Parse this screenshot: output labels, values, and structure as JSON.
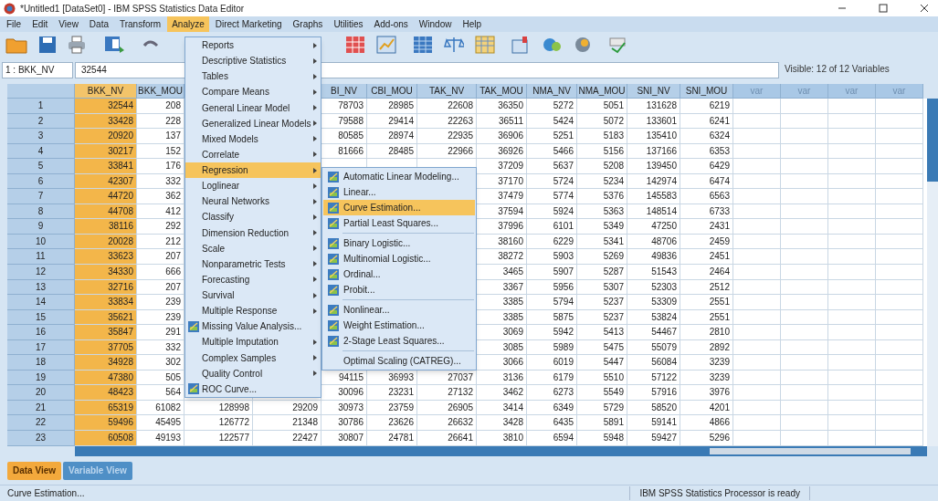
{
  "window": {
    "title": "*Untitled1 [DataSet0] - IBM SPSS Statistics Data Editor"
  },
  "menu_bar": [
    {
      "label": "File",
      "selected": false
    },
    {
      "label": "Edit",
      "selected": false
    },
    {
      "label": "View",
      "selected": false
    },
    {
      "label": "Data",
      "selected": false
    },
    {
      "label": "Transform",
      "selected": false
    },
    {
      "label": "Analyze",
      "selected": true
    },
    {
      "label": "Direct Marketing",
      "selected": false
    },
    {
      "label": "Graphs",
      "selected": false
    },
    {
      "label": "Utilities",
      "selected": false
    },
    {
      "label": "Add-ons",
      "selected": false
    },
    {
      "label": "Window",
      "selected": false
    },
    {
      "label": "Help",
      "selected": false
    }
  ],
  "analyze_menu": {
    "items": [
      {
        "label": "Reports",
        "has_submenu": true,
        "has_icon": false,
        "selected": false
      },
      {
        "label": "Descriptive Statistics",
        "has_submenu": true,
        "has_icon": false,
        "selected": false
      },
      {
        "label": "Tables",
        "has_submenu": true,
        "has_icon": false,
        "selected": false
      },
      {
        "label": "Compare Means",
        "has_submenu": true,
        "has_icon": false,
        "selected": false
      },
      {
        "label": "General Linear Model",
        "has_submenu": true,
        "has_icon": false,
        "selected": false
      },
      {
        "label": "Generalized Linear Models",
        "has_submenu": true,
        "has_icon": false,
        "selected": false
      },
      {
        "label": "Mixed Models",
        "has_submenu": true,
        "has_icon": false,
        "selected": false
      },
      {
        "label": "Correlate",
        "has_submenu": true,
        "has_icon": false,
        "selected": false
      },
      {
        "label": "Regression",
        "has_submenu": true,
        "has_icon": false,
        "selected": true
      },
      {
        "label": "Loglinear",
        "has_submenu": true,
        "has_icon": false,
        "selected": false
      },
      {
        "label": "Neural Networks",
        "has_submenu": true,
        "has_icon": false,
        "selected": false
      },
      {
        "label": "Classify",
        "has_submenu": true,
        "has_icon": false,
        "selected": false
      },
      {
        "label": "Dimension Reduction",
        "has_submenu": true,
        "has_icon": false,
        "selected": false
      },
      {
        "label": "Scale",
        "has_submenu": true,
        "has_icon": false,
        "selected": false
      },
      {
        "label": "Nonparametric Tests",
        "has_submenu": true,
        "has_icon": false,
        "selected": false
      },
      {
        "label": "Forecasting",
        "has_submenu": true,
        "has_icon": false,
        "selected": false
      },
      {
        "label": "Survival",
        "has_submenu": true,
        "has_icon": false,
        "selected": false
      },
      {
        "label": "Multiple Response",
        "has_submenu": true,
        "has_icon": false,
        "selected": false
      },
      {
        "label": "Missing Value Analysis...",
        "has_submenu": false,
        "has_icon": true,
        "selected": false
      },
      {
        "label": "Multiple Imputation",
        "has_submenu": true,
        "has_icon": false,
        "selected": false
      },
      {
        "label": "Complex Samples",
        "has_submenu": true,
        "has_icon": false,
        "selected": false
      },
      {
        "label": "Quality Control",
        "has_submenu": true,
        "has_icon": false,
        "selected": false
      },
      {
        "label": "ROC Curve...",
        "has_submenu": false,
        "has_icon": true,
        "selected": false
      }
    ]
  },
  "regression_submenu": {
    "groups": [
      [
        {
          "label": "Automatic Linear Modeling...",
          "has_icon": true,
          "selected": false
        },
        {
          "label": "Linear...",
          "has_icon": true,
          "selected": false
        },
        {
          "label": "Curve Estimation...",
          "has_icon": true,
          "selected": true
        },
        {
          "label": "Partial Least Squares...",
          "has_icon": true,
          "selected": false
        }
      ],
      [
        {
          "label": "Binary Logistic...",
          "has_icon": true,
          "selected": false
        },
        {
          "label": "Multinomial Logistic...",
          "has_icon": true,
          "selected": false
        },
        {
          "label": "Ordinal...",
          "has_icon": true,
          "selected": false
        },
        {
          "label": "Probit...",
          "has_icon": true,
          "selected": false
        }
      ],
      [
        {
          "label": "Nonlinear...",
          "has_icon": true,
          "selected": false
        },
        {
          "label": "Weight Estimation...",
          "has_icon": true,
          "selected": false
        },
        {
          "label": "2-Stage Least Squares...",
          "has_icon": true,
          "selected": false
        }
      ],
      [
        {
          "label": "Optimal Scaling (CATREG)...",
          "has_icon": false,
          "selected": false
        }
      ]
    ]
  },
  "cell_bar": {
    "cell_ref": "1 : BKK_NV",
    "value": "32544",
    "visible_count": "Visible: 12 of 12 Variables"
  },
  "table": {
    "columns": [
      {
        "label": "BKK_NV",
        "kind": "variable",
        "selected": true
      },
      {
        "label": "BKK_MOU",
        "kind": "variable",
        "selected": false
      },
      {
        "kind": "variable",
        "selected": false
      },
      {
        "kind": "variable",
        "selected": false
      },
      {
        "label": "BI_NV",
        "kind": "variable",
        "selected": false
      },
      {
        "label": "CBI_MOU",
        "kind": "variable",
        "selected": false
      },
      {
        "label": "TAK_NV",
        "kind": "variable",
        "selected": false
      },
      {
        "label": "TAK_MOU",
        "kind": "variable",
        "selected": false
      },
      {
        "label": "NMA_NV",
        "kind": "variable",
        "selected": false
      },
      {
        "label": "NMA_MOU",
        "kind": "variable",
        "selected": false
      },
      {
        "label": "SNI_NV",
        "kind": "variable",
        "selected": false
      },
      {
        "label": "SNI_MOU",
        "kind": "variable",
        "selected": false
      },
      {
        "label": "var",
        "kind": "placeholder",
        "selected": false
      },
      {
        "label": "var",
        "kind": "placeholder",
        "selected": false
      },
      {
        "label": "var",
        "kind": "placeholder",
        "selected": false
      },
      {
        "label": "var",
        "kind": "placeholder",
        "selected": false
      }
    ],
    "rows": [
      {
        "number": "1",
        "cells": [
          "32544",
          "208",
          null,
          null,
          "78703",
          "28985",
          "22608",
          "36350",
          "5272",
          "5051",
          "131628",
          "6219"
        ]
      },
      {
        "number": "2",
        "cells": [
          "33428",
          "228",
          null,
          null,
          "79588",
          "29414",
          "22263",
          "36511",
          "5424",
          "5072",
          "133601",
          "6241"
        ]
      },
      {
        "number": "3",
        "cells": [
          "20920",
          "137",
          null,
          null,
          "80585",
          "28974",
          "22935",
          "36906",
          "5251",
          "5183",
          "135410",
          "6324"
        ]
      },
      {
        "number": "4",
        "cells": [
          "30217",
          "152",
          null,
          null,
          "81666",
          "28485",
          "22966",
          "36926",
          "5466",
          "5156",
          "137166",
          "6353"
        ]
      },
      {
        "number": "5",
        "cells": [
          "33841",
          "176",
          null,
          null,
          null,
          null,
          null,
          "37209",
          "5637",
          "5208",
          "139450",
          "6429"
        ]
      },
      {
        "number": "6",
        "cells": [
          "42307",
          "332",
          null,
          null,
          null,
          null,
          null,
          "37170",
          "5724",
          "5234",
          "142974",
          "6474"
        ]
      },
      {
        "number": "7",
        "cells": [
          "44720",
          "362",
          null,
          null,
          null,
          null,
          null,
          "37479",
          "5774",
          "5376",
          "145583",
          "6563"
        ]
      },
      {
        "number": "8",
        "cells": [
          "44708",
          "412",
          null,
          null,
          null,
          null,
          null,
          "37594",
          "5924",
          "5363",
          "148514",
          "6733"
        ]
      },
      {
        "number": "9",
        "cells": [
          "38116",
          "292",
          null,
          null,
          null,
          null,
          null,
          "37996",
          "6101",
          "5349",
          "47250",
          "2431"
        ]
      },
      {
        "number": "10",
        "cells": [
          "20028",
          "212",
          null,
          null,
          null,
          null,
          null,
          "38160",
          "6229",
          "5341",
          "48706",
          "2459"
        ]
      },
      {
        "number": "11",
        "cells": [
          "33623",
          "207",
          null,
          null,
          null,
          null,
          null,
          "38272",
          "5903",
          "5269",
          "49836",
          "2451"
        ]
      },
      {
        "number": "12",
        "cells": [
          "34330",
          "666",
          null,
          null,
          null,
          null,
          null,
          "3465",
          "5907",
          "5287",
          "51543",
          "2464"
        ]
      },
      {
        "number": "13",
        "cells": [
          "32716",
          "207",
          null,
          null,
          null,
          null,
          null,
          "3367",
          "5956",
          "5307",
          "52303",
          "2512"
        ]
      },
      {
        "number": "14",
        "cells": [
          "33834",
          "239",
          null,
          null,
          null,
          null,
          null,
          "3385",
          "5794",
          "5237",
          "53309",
          "2551"
        ]
      },
      {
        "number": "15",
        "cells": [
          "35621",
          "239",
          null,
          null,
          null,
          null,
          null,
          "3385",
          "5875",
          "5237",
          "53824",
          "2551"
        ]
      },
      {
        "number": "16",
        "cells": [
          "35847",
          "291",
          null,
          null,
          null,
          null,
          null,
          "3069",
          "5942",
          "5413",
          "54467",
          "2810"
        ]
      },
      {
        "number": "17",
        "cells": [
          "37705",
          "332",
          null,
          null,
          null,
          null,
          null,
          "3085",
          "5989",
          "5475",
          "55079",
          "2892"
        ]
      },
      {
        "number": "18",
        "cells": [
          "34928",
          "302",
          null,
          null,
          null,
          null,
          null,
          "3066",
          "6019",
          "5447",
          "56084",
          "3239"
        ]
      },
      {
        "number": "19",
        "cells": [
          "47380",
          "505",
          null,
          null,
          "94115",
          "36993",
          "27037",
          "3136",
          "6179",
          "5510",
          "57122",
          "3239"
        ]
      },
      {
        "number": "20",
        "cells": [
          "48423",
          "564",
          null,
          null,
          "30096",
          "23231",
          "27132",
          "3462",
          "6273",
          "5549",
          "57916",
          "3976"
        ]
      },
      {
        "number": "21",
        "cells": [
          "65319",
          "61082",
          "128998",
          "29209",
          "30973",
          "23759",
          "26905",
          "3414",
          "6349",
          "5729",
          "58520",
          "4201"
        ]
      },
      {
        "number": "22",
        "cells": [
          "59496",
          "45495",
          "126772",
          "21348",
          "30786",
          "23626",
          "26632",
          "3428",
          "6435",
          "5891",
          "59141",
          "4866"
        ]
      },
      {
        "number": "23",
        "cells": [
          "60508",
          "49193",
          "122577",
          "22427",
          "30807",
          "24781",
          "26641",
          "3810",
          "6594",
          "5948",
          "59427",
          "5296"
        ]
      }
    ]
  },
  "view_tabs": [
    {
      "label": "Data View",
      "selected": true
    },
    {
      "label": "Variable View",
      "selected": false
    }
  ],
  "status_bar": {
    "message": "Curve Estimation...",
    "processor_status": "IBM SPSS Statistics Processor is ready"
  }
}
